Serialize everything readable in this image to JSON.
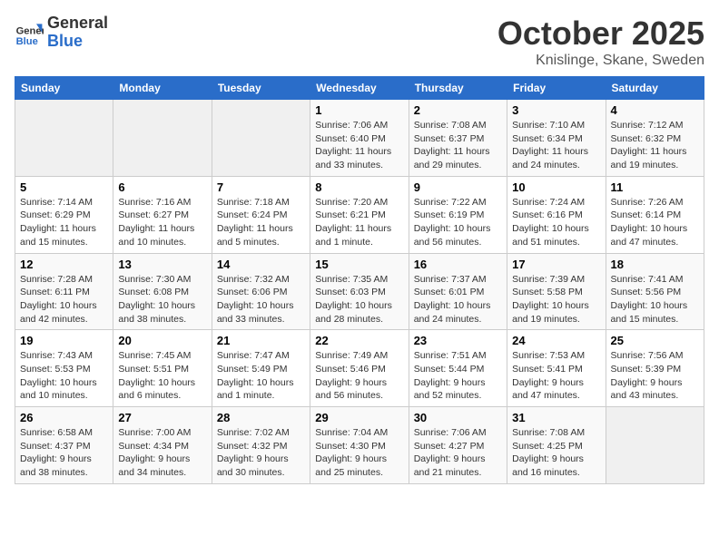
{
  "header": {
    "logo_line1": "General",
    "logo_line2": "Blue",
    "month": "October 2025",
    "location": "Knislinge, Skane, Sweden"
  },
  "weekdays": [
    "Sunday",
    "Monday",
    "Tuesday",
    "Wednesday",
    "Thursday",
    "Friday",
    "Saturday"
  ],
  "weeks": [
    [
      {
        "day": "",
        "info": ""
      },
      {
        "day": "",
        "info": ""
      },
      {
        "day": "",
        "info": ""
      },
      {
        "day": "1",
        "info": "Sunrise: 7:06 AM\nSunset: 6:40 PM\nDaylight: 11 hours\nand 33 minutes."
      },
      {
        "day": "2",
        "info": "Sunrise: 7:08 AM\nSunset: 6:37 PM\nDaylight: 11 hours\nand 29 minutes."
      },
      {
        "day": "3",
        "info": "Sunrise: 7:10 AM\nSunset: 6:34 PM\nDaylight: 11 hours\nand 24 minutes."
      },
      {
        "day": "4",
        "info": "Sunrise: 7:12 AM\nSunset: 6:32 PM\nDaylight: 11 hours\nand 19 minutes."
      }
    ],
    [
      {
        "day": "5",
        "info": "Sunrise: 7:14 AM\nSunset: 6:29 PM\nDaylight: 11 hours\nand 15 minutes."
      },
      {
        "day": "6",
        "info": "Sunrise: 7:16 AM\nSunset: 6:27 PM\nDaylight: 11 hours\nand 10 minutes."
      },
      {
        "day": "7",
        "info": "Sunrise: 7:18 AM\nSunset: 6:24 PM\nDaylight: 11 hours\nand 5 minutes."
      },
      {
        "day": "8",
        "info": "Sunrise: 7:20 AM\nSunset: 6:21 PM\nDaylight: 11 hours\nand 1 minute."
      },
      {
        "day": "9",
        "info": "Sunrise: 7:22 AM\nSunset: 6:19 PM\nDaylight: 10 hours\nand 56 minutes."
      },
      {
        "day": "10",
        "info": "Sunrise: 7:24 AM\nSunset: 6:16 PM\nDaylight: 10 hours\nand 51 minutes."
      },
      {
        "day": "11",
        "info": "Sunrise: 7:26 AM\nSunset: 6:14 PM\nDaylight: 10 hours\nand 47 minutes."
      }
    ],
    [
      {
        "day": "12",
        "info": "Sunrise: 7:28 AM\nSunset: 6:11 PM\nDaylight: 10 hours\nand 42 minutes."
      },
      {
        "day": "13",
        "info": "Sunrise: 7:30 AM\nSunset: 6:08 PM\nDaylight: 10 hours\nand 38 minutes."
      },
      {
        "day": "14",
        "info": "Sunrise: 7:32 AM\nSunset: 6:06 PM\nDaylight: 10 hours\nand 33 minutes."
      },
      {
        "day": "15",
        "info": "Sunrise: 7:35 AM\nSunset: 6:03 PM\nDaylight: 10 hours\nand 28 minutes."
      },
      {
        "day": "16",
        "info": "Sunrise: 7:37 AM\nSunset: 6:01 PM\nDaylight: 10 hours\nand 24 minutes."
      },
      {
        "day": "17",
        "info": "Sunrise: 7:39 AM\nSunset: 5:58 PM\nDaylight: 10 hours\nand 19 minutes."
      },
      {
        "day": "18",
        "info": "Sunrise: 7:41 AM\nSunset: 5:56 PM\nDaylight: 10 hours\nand 15 minutes."
      }
    ],
    [
      {
        "day": "19",
        "info": "Sunrise: 7:43 AM\nSunset: 5:53 PM\nDaylight: 10 hours\nand 10 minutes."
      },
      {
        "day": "20",
        "info": "Sunrise: 7:45 AM\nSunset: 5:51 PM\nDaylight: 10 hours\nand 6 minutes."
      },
      {
        "day": "21",
        "info": "Sunrise: 7:47 AM\nSunset: 5:49 PM\nDaylight: 10 hours\nand 1 minute."
      },
      {
        "day": "22",
        "info": "Sunrise: 7:49 AM\nSunset: 5:46 PM\nDaylight: 9 hours\nand 56 minutes."
      },
      {
        "day": "23",
        "info": "Sunrise: 7:51 AM\nSunset: 5:44 PM\nDaylight: 9 hours\nand 52 minutes."
      },
      {
        "day": "24",
        "info": "Sunrise: 7:53 AM\nSunset: 5:41 PM\nDaylight: 9 hours\nand 47 minutes."
      },
      {
        "day": "25",
        "info": "Sunrise: 7:56 AM\nSunset: 5:39 PM\nDaylight: 9 hours\nand 43 minutes."
      }
    ],
    [
      {
        "day": "26",
        "info": "Sunrise: 6:58 AM\nSunset: 4:37 PM\nDaylight: 9 hours\nand 38 minutes."
      },
      {
        "day": "27",
        "info": "Sunrise: 7:00 AM\nSunset: 4:34 PM\nDaylight: 9 hours\nand 34 minutes."
      },
      {
        "day": "28",
        "info": "Sunrise: 7:02 AM\nSunset: 4:32 PM\nDaylight: 9 hours\nand 30 minutes."
      },
      {
        "day": "29",
        "info": "Sunrise: 7:04 AM\nSunset: 4:30 PM\nDaylight: 9 hours\nand 25 minutes."
      },
      {
        "day": "30",
        "info": "Sunrise: 7:06 AM\nSunset: 4:27 PM\nDaylight: 9 hours\nand 21 minutes."
      },
      {
        "day": "31",
        "info": "Sunrise: 7:08 AM\nSunset: 4:25 PM\nDaylight: 9 hours\nand 16 minutes."
      },
      {
        "day": "",
        "info": ""
      }
    ]
  ]
}
